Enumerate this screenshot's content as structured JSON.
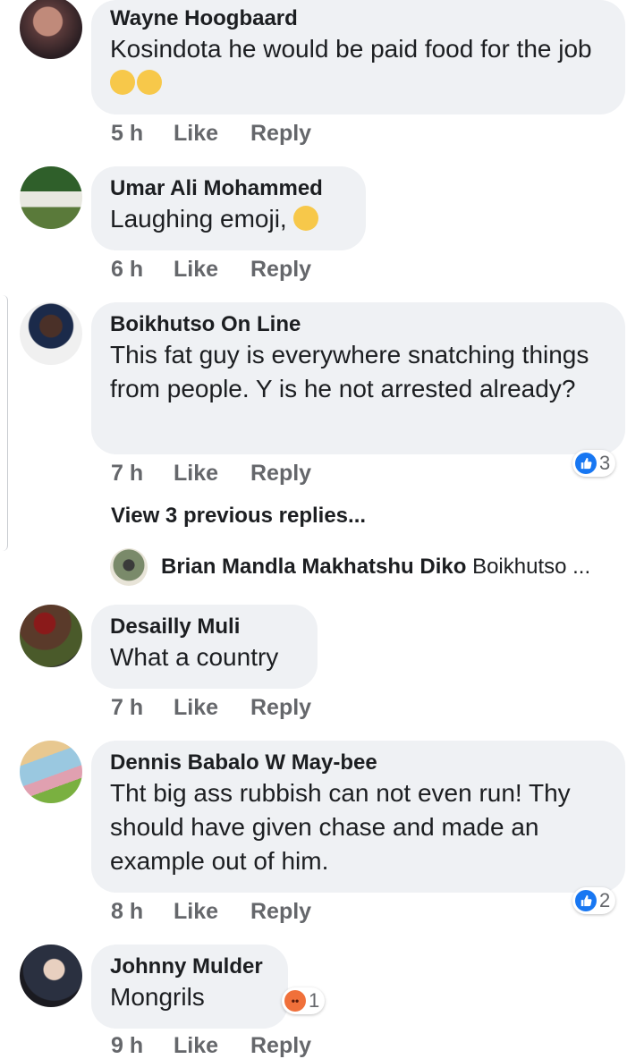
{
  "comments": [
    {
      "name": "Wayne Hoogbaard",
      "text": "Kosindota he would be paid food for the job",
      "time": "5 h"
    },
    {
      "name": "Umar Ali Mohammed",
      "text": "Laughing emoji,",
      "time": "6 h"
    },
    {
      "name": "Boikhutso On Line",
      "text": "This fat guy is everywhere snatching things from people. Y is he not arrested already?",
      "time": "7 h",
      "reaction_count": "3",
      "view_replies": "View 3 previous replies...",
      "reply_preview": {
        "name": "Brian Mandla Makhatshu Diko",
        "text": "Boikhutso ..."
      }
    },
    {
      "name": "Desailly Muli",
      "text": "What a country",
      "time": "7 h"
    },
    {
      "name": "Dennis Babalo W May-bee",
      "text": "Tht big ass rubbish can not even run! Thy should have given chase and made an example out of him.",
      "time": "8 h",
      "reaction_count": "2"
    },
    {
      "name": "Johnny Mulder",
      "text": "Mongrils",
      "time": "9 h",
      "reaction_count": "1"
    }
  ],
  "actions": {
    "like": "Like",
    "reply": "Reply"
  },
  "colors": {
    "like_blue": "#1877f2",
    "angry_orange": "#f0703a",
    "bubble": "#eff1f4"
  }
}
